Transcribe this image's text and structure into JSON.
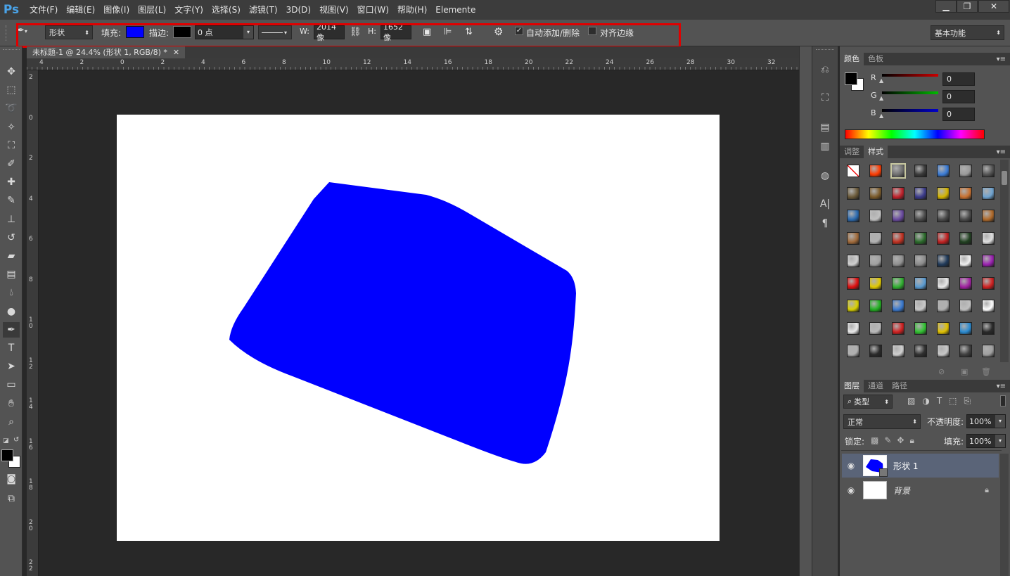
{
  "app": {
    "logo": "Ps"
  },
  "menu": [
    "文件(F)",
    "编辑(E)",
    "图像(I)",
    "图层(L)",
    "文字(Y)",
    "选择(S)",
    "滤镜(T)",
    "3D(D)",
    "视图(V)",
    "窗口(W)",
    "帮助(H)",
    "Elemente"
  ],
  "window_buttons": [
    "minimize-icon",
    "restore-icon",
    "close-icon"
  ],
  "options": {
    "mode": "形状",
    "fill_label": "填充:",
    "fill_color": "#0000ff",
    "stroke_label": "描边:",
    "stroke_color": "#000000",
    "stroke_width": "0 点",
    "w_label": "W:",
    "w_value": "2014 像",
    "h_label": "H:",
    "h_value": "1652 像",
    "auto_add_delete": "自动添加/删除",
    "auto_add_delete_checked": true,
    "align_edges": "对齐边缘",
    "align_edges_checked": false,
    "workspace": "基本功能"
  },
  "document": {
    "tab_title": "未标题-1 @ 24.4% (形状 1, RGB/8) *",
    "shape_color": "#0000ff",
    "ruler_top": [
      "4",
      "2",
      "0",
      "2",
      "4",
      "6",
      "8",
      "10",
      "12",
      "14",
      "16",
      "18",
      "20",
      "22",
      "24",
      "26",
      "28",
      "30",
      "32"
    ],
    "ruler_left": [
      "2",
      "0",
      "2",
      "4",
      "6",
      "8",
      "10",
      "12",
      "14",
      "16",
      "18",
      "20",
      "22"
    ]
  },
  "tools": [
    "move-tool-icon",
    "marquee-tool-icon",
    "lasso-tool-icon",
    "quick-select-tool-icon",
    "crop-tool-icon",
    "eyedropper-tool-icon",
    "healing-brush-tool-icon",
    "brush-tool-icon",
    "stamp-tool-icon",
    "history-brush-tool-icon",
    "eraser-tool-icon",
    "gradient-tool-icon",
    "blur-tool-icon",
    "dodge-tool-icon",
    "pen-tool-icon",
    "type-tool-icon",
    "path-select-tool-icon",
    "shape-tool-icon",
    "hand-tool-icon",
    "zoom-tool-icon"
  ],
  "color_panel": {
    "tabs": [
      "颜色",
      "色板"
    ],
    "channels": [
      {
        "label": "R",
        "value": "0",
        "color": "#cc0000"
      },
      {
        "label": "G",
        "value": "0",
        "color": "#00bb00"
      },
      {
        "label": "B",
        "value": "0",
        "color": "#0000cc"
      }
    ],
    "foreground": "#000000",
    "background": "#ffffff"
  },
  "styles_panel": {
    "tabs": [
      "调整",
      "样式"
    ],
    "swatch_colors": [
      "#ffffff",
      "#ff3b00",
      "#6b6b6b",
      "#3a3a3a",
      "#3a7bd5",
      "#9a9a9a",
      "#555555",
      "#6b5a3a",
      "#7a5a2a",
      "#c0202a",
      "#3a3a8a",
      "#d4b400",
      "#c87030",
      "#6fa3d0",
      "#2a6ab0",
      "#c0c0c0",
      "#6a4aa0",
      "#4a4a4a",
      "#4a4a4a",
      "#4a4a4a",
      "#b06a2a",
      "#a06a3a",
      "#b0b0b0",
      "#c03020",
      "#2a6a2a",
      "#c02020",
      "#204020",
      "#e0e0e0",
      "#d0d0d0",
      "#a0a0a0",
      "#909090",
      "#8a8a8a",
      "#203a5a",
      "#f0f0f0",
      "#9a20b0",
      "#e01010",
      "#e0c800",
      "#30b030",
      "#5a9ad0",
      "#e8e8e8",
      "#a020a0",
      "#d02020",
      "#d8d000",
      "#20b020",
      "#3a7ad0",
      "#c8c8c8",
      "#b0b0b0",
      "#c0c0c0",
      "#ffffff",
      "#e8e8e8",
      "#b8b8b8",
      "#d02020",
      "#30c030",
      "#e0c000",
      "#2a8ad0",
      "#2a2a2a",
      "#b0b0b0",
      "#2a2a2a",
      "#d0d0d0",
      "#303030",
      "#c8c8c8",
      "#404040",
      "#a0a0a0"
    ]
  },
  "layers_panel": {
    "tabs": [
      "图层",
      "通道",
      "路径"
    ],
    "filter": "类型",
    "blend_mode": "正常",
    "opacity_label": "不透明度:",
    "opacity": "100%",
    "lock_label": "锁定:",
    "fill_label": "填充:",
    "fill": "100%",
    "layers": [
      {
        "name": "形状 1",
        "selected": true
      },
      {
        "name": "背景",
        "selected": false,
        "locked": true
      }
    ]
  }
}
